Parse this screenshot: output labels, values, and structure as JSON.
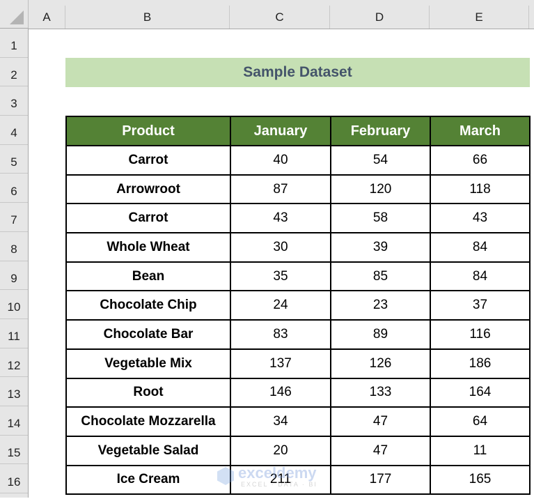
{
  "column_headers": [
    "A",
    "B",
    "C",
    "D",
    "E"
  ],
  "row_headers": [
    "1",
    "2",
    "3",
    "4",
    "5",
    "6",
    "7",
    "8",
    "9",
    "10",
    "11",
    "12",
    "13",
    "14",
    "15",
    "16"
  ],
  "title": "Sample Dataset",
  "table": {
    "headers": [
      "Product",
      "January",
      "February",
      "March"
    ],
    "rows": [
      [
        "Carrot",
        "40",
        "54",
        "66"
      ],
      [
        "Arrowroot",
        "87",
        "120",
        "118"
      ],
      [
        "Carrot",
        "43",
        "58",
        "43"
      ],
      [
        "Whole Wheat",
        "30",
        "39",
        "84"
      ],
      [
        "Bean",
        "35",
        "85",
        "84"
      ],
      [
        "Chocolate Chip",
        "24",
        "23",
        "37"
      ],
      [
        "Chocolate Bar",
        "83",
        "89",
        "116"
      ],
      [
        "Vegetable Mix",
        "137",
        "126",
        "186"
      ],
      [
        "Root",
        "146",
        "133",
        "164"
      ],
      [
        "Chocolate Mozzarella",
        "34",
        "47",
        "64"
      ],
      [
        "Vegetable Salad",
        "20",
        "47",
        "11"
      ],
      [
        "Ice Cream",
        "211",
        "177",
        "165"
      ]
    ]
  },
  "watermark": {
    "brand": "exceldemy",
    "tagline": "EXCEL · DATA · BI"
  },
  "colors": {
    "header_green": "#548235",
    "title_fill": "#c6e0b4",
    "title_text": "#44546a"
  }
}
